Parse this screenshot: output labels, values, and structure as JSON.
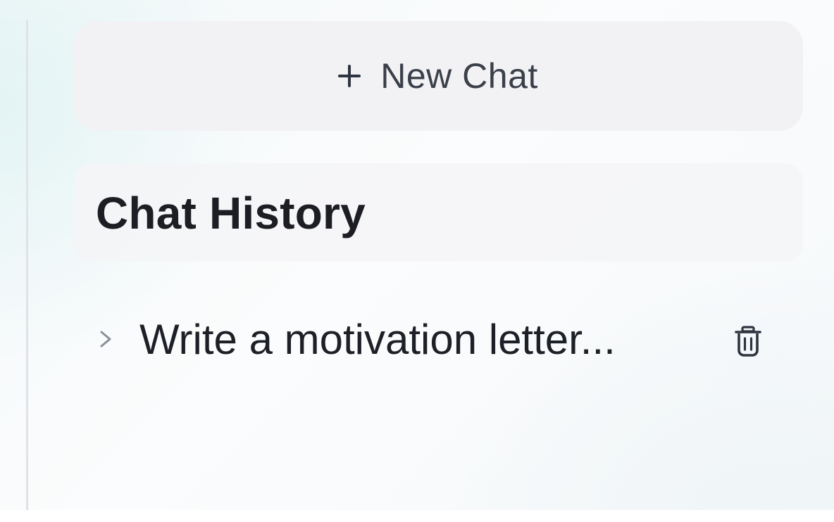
{
  "sidebar": {
    "new_chat": {
      "label": "New Chat",
      "icon": "plus-icon"
    },
    "history": {
      "title": "Chat History",
      "items": [
        {
          "label": "Write a motivation letter...",
          "expand_icon": "chevron-right-icon",
          "delete_icon": "trash-icon"
        }
      ]
    }
  },
  "colors": {
    "button_bg": "#f2f2f4",
    "text_primary": "#1c1e24",
    "text_secondary": "#3a3f4a",
    "icon": "#2f3440",
    "chevron": "#8a8f99"
  }
}
